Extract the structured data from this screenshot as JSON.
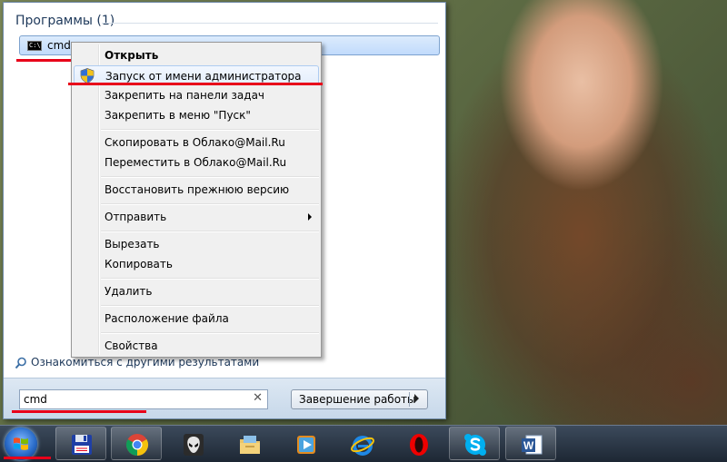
{
  "start_menu": {
    "programs_header": "Программы (1)",
    "result_label": "cmd",
    "cmd_icon_text": "C:\\",
    "see_more": "Ознакомиться с другими результатами",
    "search_value": "cmd",
    "clear_glyph": "✕",
    "shutdown_label": "Завершение работы"
  },
  "context_menu": {
    "items": [
      {
        "label": "Открыть"
      },
      {
        "label": "Запуск от имени администратора"
      },
      {
        "label": "Закрепить на панели задач"
      },
      {
        "label": "Закрепить в меню \"Пуск\""
      },
      {
        "label": "Скопировать в Облако@Mail.Ru"
      },
      {
        "label": "Переместить в Облако@Mail.Ru"
      },
      {
        "label": "Восстановить прежнюю версию"
      },
      {
        "label": "Отправить"
      },
      {
        "label": "Вырезать"
      },
      {
        "label": "Копировать"
      },
      {
        "label": "Удалить"
      },
      {
        "label": "Расположение файла"
      },
      {
        "label": "Свойства"
      }
    ]
  },
  "taskbar": {
    "icons": [
      "floppy-disk-icon",
      "chrome-icon",
      "alien-icon",
      "file-explorer-icon",
      "media-player-icon",
      "internet-explorer-icon",
      "opera-icon",
      "skype-icon",
      "word-icon"
    ],
    "word_letter": "W"
  },
  "colors": {
    "highlight_red": "#e8001a",
    "accent_blue": "#1e395b"
  }
}
